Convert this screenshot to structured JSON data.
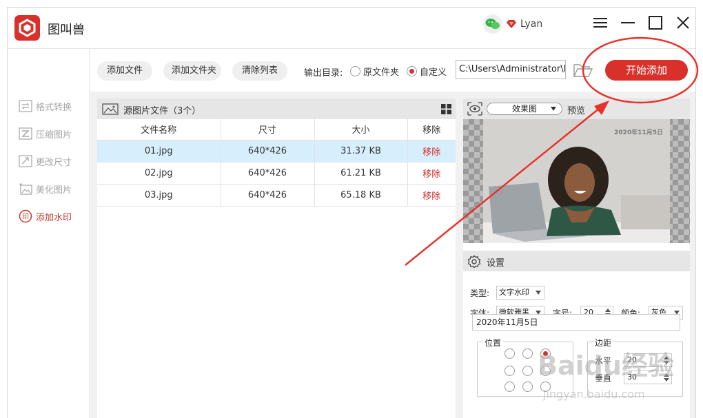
{
  "app": {
    "name": "图叫兽"
  },
  "user": {
    "name": "Lyan"
  },
  "sidebar": {
    "items": [
      {
        "label": "格式转换",
        "icon": "format-convert-icon",
        "active": false
      },
      {
        "label": "压缩图片",
        "icon": "compress-icon",
        "active": false
      },
      {
        "label": "更改尺寸",
        "icon": "resize-icon",
        "active": false
      },
      {
        "label": "美化图片",
        "icon": "beautify-icon",
        "active": false
      },
      {
        "label": "添加水印",
        "icon": "watermark-icon",
        "active": true
      }
    ]
  },
  "toolbar": {
    "add_file": "添加文件",
    "add_folder": "添加文件夹",
    "clear_list": "清除列表",
    "output_label": "输出目录:",
    "option_original": "原文件夹",
    "option_custom": "自定义",
    "output_path": "C:\\Users\\Administrator\\I",
    "start_button": "开始添加"
  },
  "file_list": {
    "title": "源图片文件（3个）",
    "columns": [
      "文件名称",
      "尺寸",
      "大小",
      "移除"
    ],
    "rows": [
      {
        "name": "01.jpg",
        "size": "640*426",
        "filesize": "31.37 KB",
        "remove": "移除"
      },
      {
        "name": "02.jpg",
        "size": "640*426",
        "filesize": "61.21 KB",
        "remove": "移除"
      },
      {
        "name": "03.jpg",
        "size": "640*426",
        "filesize": "65.18 KB",
        "remove": "移除"
      }
    ]
  },
  "preview": {
    "view_mode": "效果图",
    "label": "预览",
    "watermark_text": "2020年11月5日"
  },
  "settings": {
    "title": "设置",
    "type_label": "类型:",
    "type_value": "文字水印",
    "font_label": "字体:",
    "font_value": "微软雅黑",
    "size_label": "字号:",
    "size_value": "20",
    "color_label": "颜色:",
    "color_value": "灰色",
    "text_value": "2020年11月5日",
    "position_label": "位置",
    "margin_label": "边距",
    "horizontal_label": "水平",
    "horizontal_value": "20",
    "vertical_label": "垂直",
    "vertical_value": "30"
  },
  "site_watermark": {
    "main": "Baidu经验",
    "sub": "jingyan.baidu.com"
  },
  "colors": {
    "accent": "#d8312b",
    "selected_row": "#d7effd"
  }
}
